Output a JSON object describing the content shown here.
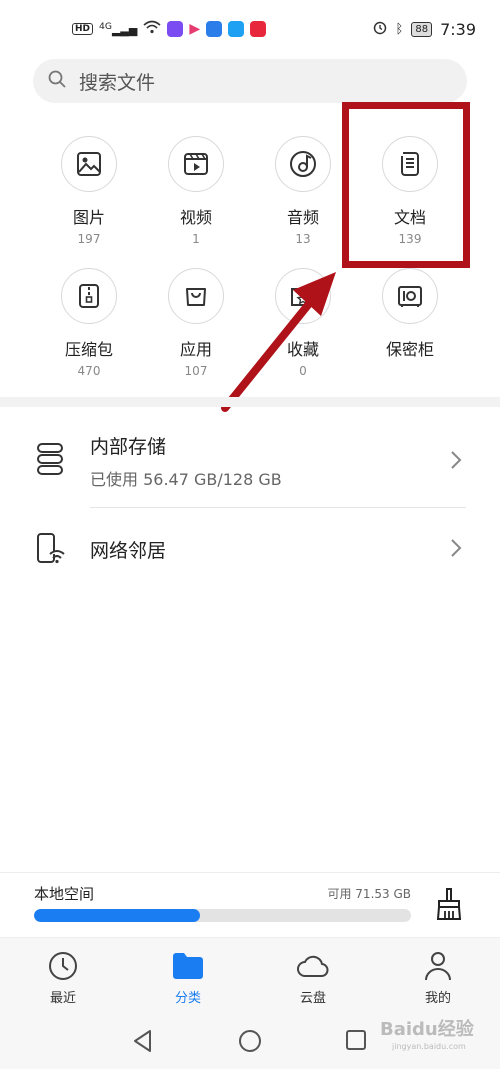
{
  "status_bar": {
    "left_badges": [
      "HD",
      "4G"
    ],
    "battery": "88",
    "time": "7:39"
  },
  "search": {
    "placeholder": "搜索文件"
  },
  "categories": [
    {
      "label": "图片",
      "count": "197",
      "icon": "image-icon"
    },
    {
      "label": "视频",
      "count": "1",
      "icon": "video-icon"
    },
    {
      "label": "音频",
      "count": "13",
      "icon": "audio-icon"
    },
    {
      "label": "文档",
      "count": "139",
      "icon": "document-icon"
    },
    {
      "label": "压缩包",
      "count": "470",
      "icon": "archive-icon"
    },
    {
      "label": "应用",
      "count": "107",
      "icon": "app-bag-icon"
    },
    {
      "label": "收藏",
      "count": "0",
      "icon": "favorites-icon"
    },
    {
      "label": "保密柜",
      "count": "",
      "icon": "safe-icon"
    }
  ],
  "locations": {
    "internal": {
      "title": "内部存储",
      "subtitle": "已使用 56.47 GB/128 GB"
    },
    "network": {
      "title": "网络邻居"
    }
  },
  "storage": {
    "label": "本地空间",
    "available": "可用 71.53 GB",
    "used_fraction": 0.44
  },
  "bottom_nav": [
    {
      "label": "最近",
      "icon": "clock-icon",
      "active": false
    },
    {
      "label": "分类",
      "icon": "folder-icon",
      "active": true
    },
    {
      "label": "云盘",
      "icon": "cloud-icon",
      "active": false
    },
    {
      "label": "我的",
      "icon": "person-icon",
      "active": false
    }
  ],
  "watermark": {
    "brand": "Baidu经验",
    "url": "jingyan.baidu.com"
  },
  "colors": {
    "accent": "#1a7ef2",
    "annotation": "#b0121a"
  }
}
